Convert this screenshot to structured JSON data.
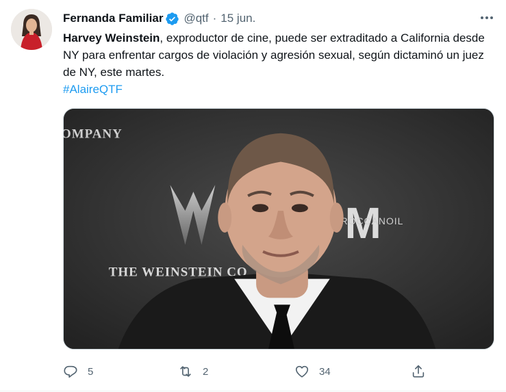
{
  "tweet": {
    "author_name": "Fernanda Familiar",
    "handle": "@qtf",
    "separator": "·",
    "date": "15 jun.",
    "text_bold": "Harvey Weinstein",
    "text_rest": ", exproductor de cine,  puede ser extraditado a California desde NY para enfrentar cargos de violación y agresión sexual, según dictaminó un juez de NY, este martes.",
    "hashtag": "#AlaireQTF"
  },
  "media": {
    "backdrop_text_1": "OMPANY",
    "backdrop_text_2": "THE WEINSTEIN CO",
    "backdrop_text_3": "M",
    "backdrop_text_4": "OROCCANOIL"
  },
  "actions": {
    "reply_count": "5",
    "retweet_count": "2",
    "like_count": "34"
  },
  "colors": {
    "accent": "#1d9bf0",
    "secondary_text": "#536471",
    "primary_text": "#0f1419"
  },
  "icons": [
    "verified-badge-icon",
    "more-icon",
    "reply-icon",
    "retweet-icon",
    "like-icon",
    "share-icon"
  ]
}
